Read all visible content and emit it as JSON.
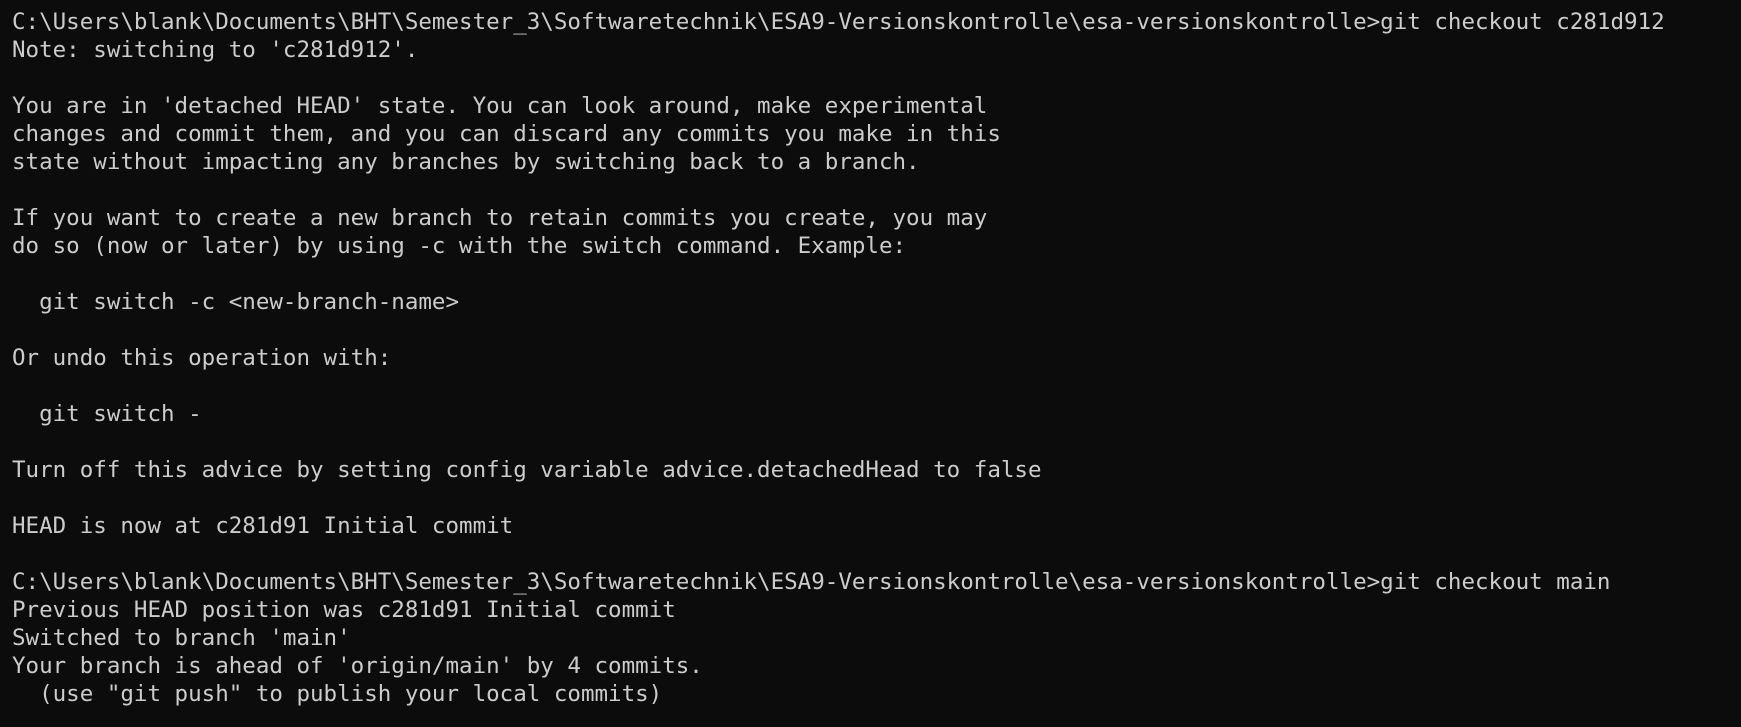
{
  "terminal": {
    "lines": [
      {
        "kind": "command",
        "prompt": "C:\\Users\\blank\\Documents\\BHT\\Semester_3\\Softwaretechnik\\ESA9-Versionskontrolle\\esa-versionskontrolle>",
        "command": "git checkout c281d912"
      },
      {
        "kind": "output",
        "text": "Note: switching to 'c281d912'."
      },
      {
        "kind": "output",
        "text": ""
      },
      {
        "kind": "output",
        "text": "You are in 'detached HEAD' state. You can look around, make experimental"
      },
      {
        "kind": "output",
        "text": "changes and commit them, and you can discard any commits you make in this"
      },
      {
        "kind": "output",
        "text": "state without impacting any branches by switching back to a branch."
      },
      {
        "kind": "output",
        "text": ""
      },
      {
        "kind": "output",
        "text": "If you want to create a new branch to retain commits you create, you may"
      },
      {
        "kind": "output",
        "text": "do so (now or later) by using -c with the switch command. Example:"
      },
      {
        "kind": "output",
        "text": ""
      },
      {
        "kind": "output",
        "text": "  git switch -c <new-branch-name>"
      },
      {
        "kind": "output",
        "text": ""
      },
      {
        "kind": "output",
        "text": "Or undo this operation with:"
      },
      {
        "kind": "output",
        "text": ""
      },
      {
        "kind": "output",
        "text": "  git switch -"
      },
      {
        "kind": "output",
        "text": ""
      },
      {
        "kind": "output",
        "text": "Turn off this advice by setting config variable advice.detachedHead to false"
      },
      {
        "kind": "output",
        "text": ""
      },
      {
        "kind": "output",
        "text": "HEAD is now at c281d91 Initial commit"
      },
      {
        "kind": "output",
        "text": ""
      },
      {
        "kind": "command",
        "prompt": "C:\\Users\\blank\\Documents\\BHT\\Semester_3\\Softwaretechnik\\ESA9-Versionskontrolle\\esa-versionskontrolle>",
        "command": "git checkout main"
      },
      {
        "kind": "output",
        "text": "Previous HEAD position was c281d91 Initial commit"
      },
      {
        "kind": "output",
        "text": "Switched to branch 'main'"
      },
      {
        "kind": "output",
        "text": "Your branch is ahead of 'origin/main' by 4 commits."
      },
      {
        "kind": "output",
        "text": "  (use \"git push\" to publish your local commits)"
      }
    ]
  },
  "colors": {
    "background": "#0c0c0c",
    "foreground": "#cccccc"
  }
}
